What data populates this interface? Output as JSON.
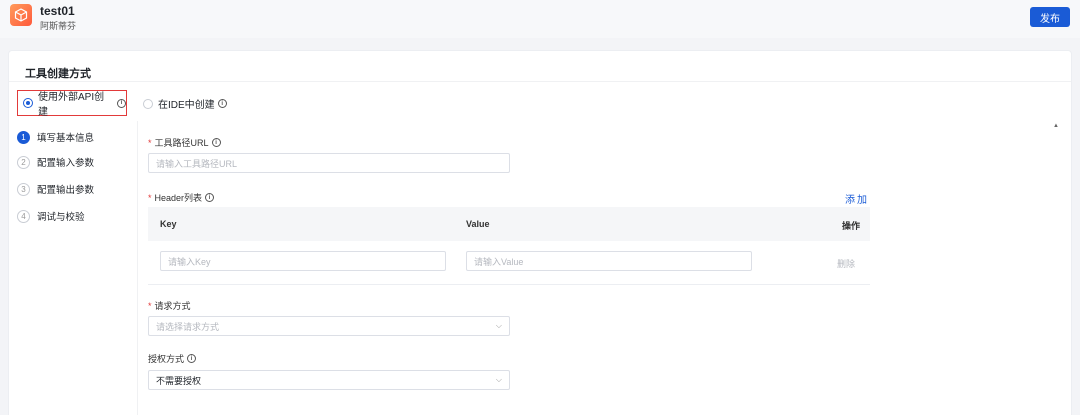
{
  "header": {
    "title": "test01",
    "subtitle": "阿斯蒂芬",
    "publish_label": "发布"
  },
  "section": {
    "title": "工具创建方式"
  },
  "methods": {
    "api": {
      "label": "使用外部API创建",
      "selected": true
    },
    "ide": {
      "label": "在IDE中创建",
      "selected": false
    }
  },
  "steps": [
    {
      "num": "1",
      "label": "填写基本信息",
      "active": true
    },
    {
      "num": "2",
      "label": "配置输入参数",
      "active": false
    },
    {
      "num": "3",
      "label": "配置输出参数",
      "active": false
    },
    {
      "num": "4",
      "label": "调试与校验",
      "active": false
    }
  ],
  "form": {
    "url": {
      "label": "工具路径URL",
      "placeholder": "请输入工具路径URL"
    },
    "headers": {
      "label": "Header列表",
      "add_label": "添加",
      "columns": {
        "key": "Key",
        "value": "Value",
        "action": "操作"
      },
      "row": {
        "key_placeholder": "请输入Key",
        "value_placeholder": "请输入Value",
        "delete_label": "删除"
      }
    },
    "method": {
      "label": "请求方式",
      "placeholder": "请选择请求方式"
    },
    "auth": {
      "label": "授权方式",
      "value": "不需要授权"
    }
  },
  "icons": {
    "info": "info-icon",
    "chevron": "chevron-down-icon",
    "logo": "cube-logo-icon"
  },
  "colors": {
    "primary": "#1a5bd6",
    "required": "#e23a3a",
    "highlight_border": "#e23a3a"
  }
}
